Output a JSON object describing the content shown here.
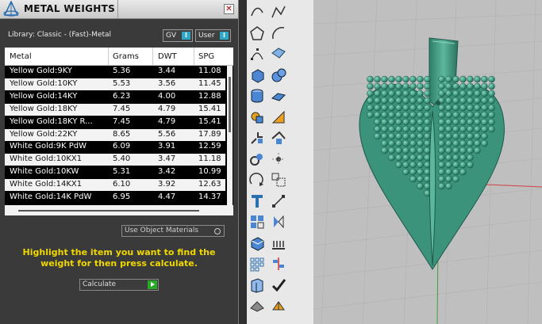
{
  "panel": {
    "title": "METAL WEIGHTS",
    "close_glyph": "✕",
    "library_label": "Library: Classic - (Fast)-Metal",
    "gv_label": "GV",
    "user_label": "User",
    "toggle_glyph": "I",
    "table": {
      "columns": [
        "Metal",
        "Grams",
        "DWT",
        "SPG"
      ],
      "rows": [
        [
          "Yellow Gold:9KY",
          "5.36",
          "3.44",
          "11.08"
        ],
        [
          "Yellow Gold:10KY",
          "5.53",
          "3.56",
          "11.45"
        ],
        [
          "Yellow Gold:14KY",
          "6.23",
          "4.00",
          "12.88"
        ],
        [
          "Yellow Gold:18KY",
          "7.45",
          "4.79",
          "15.41"
        ],
        [
          "Yellow Gold:18KY R...",
          "7.45",
          "4.79",
          "15.41"
        ],
        [
          "Yellow Gold:22KY",
          "8.65",
          "5.56",
          "17.89"
        ],
        [
          "White Gold:9K PdW",
          "6.09",
          "3.91",
          "12.59"
        ],
        [
          "White Gold:10KX1",
          "5.40",
          "3.47",
          "11.18"
        ],
        [
          "White Gold:10KW",
          "5.31",
          "3.42",
          "10.99"
        ],
        [
          "White Gold:14KX1",
          "6.10",
          "3.92",
          "12.63"
        ],
        [
          "White Gold:14K PdW",
          "6.95",
          "4.47",
          "14.37"
        ]
      ]
    },
    "use_object_materials": "Use Object Materials",
    "help_text": "Highlight the item you want to find the weight for then press calculate.",
    "calculate_label": "Calculate"
  },
  "toolbar": {
    "icons": [
      "curve-icon",
      "polyline-icon",
      "polygon-icon",
      "arc-icon",
      "control-points-icon",
      "surface-icon",
      "box-icon",
      "sphere-icon",
      "cylinder-icon",
      "plane-icon",
      "boolean-icon",
      "split-icon",
      "transform-icon",
      "move-icon",
      "group-icon",
      "point-icon",
      "rotate-icon",
      "scale-icon",
      "text-icon",
      "dimension-icon",
      "array-icon",
      "mirror-icon",
      "solid-edit-icon",
      "dimension-bars-icon",
      "grid-icon",
      "align-icon",
      "extrude-icon",
      "check-icon",
      "shape-icon",
      "material-icon"
    ]
  },
  "colors": {
    "model_green": "#3f9e84",
    "help_yellow": "#f0d800",
    "toggle_blue": "#2fa8c8"
  }
}
